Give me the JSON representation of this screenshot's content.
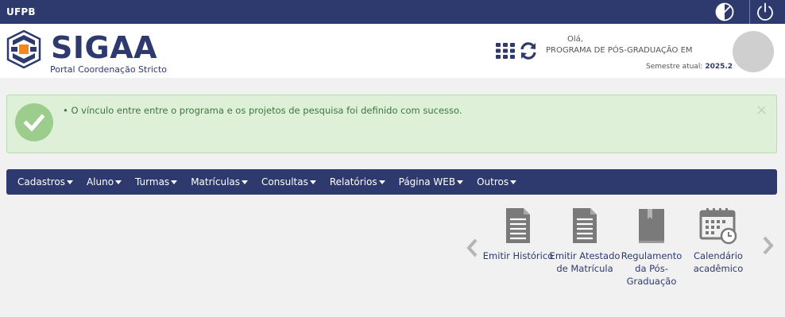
{
  "topbar": {
    "brand": "UFPB",
    "contrast_icon": "contrast-icon",
    "power_icon": "power-icon"
  },
  "header": {
    "logo_text": "SIGAA",
    "portal_subtitle": "Portal Coordenação Stricto",
    "greeting": "Olá,",
    "program": "PROGRAMA DE PÓS-GRADUAÇÃO EM",
    "semester_label": "Semestre atual:",
    "semester_value": "2025.2",
    "apps_icon": "grid-icon",
    "sync_icon": "sync-icon"
  },
  "alert": {
    "message": "• O vínculo entre entre o programa e os projetos de pesquisa foi definido com sucesso.",
    "close": "×",
    "color": "#dff0d8"
  },
  "menu": {
    "items": [
      {
        "label": "Cadastros"
      },
      {
        "label": "Aluno"
      },
      {
        "label": "Turmas"
      },
      {
        "label": "Matrículas"
      },
      {
        "label": "Consultas"
      },
      {
        "label": "Relatórios"
      },
      {
        "label": "Página WEB"
      },
      {
        "label": "Outros"
      }
    ],
    "color": "#2e3a6e"
  },
  "shortcuts": [
    {
      "label": "Emitir Histórico",
      "icon": "document-icon"
    },
    {
      "label": "Emitir Atestado de Matrícula",
      "icon": "document-icon"
    },
    {
      "label": "Regulamento da Pós-Graduação",
      "icon": "book-icon"
    },
    {
      "label": "Calendário acadêmico",
      "icon": "calendar-icon"
    }
  ],
  "colors": {
    "primary": "#2e3a6e",
    "success_text": "#3c763d",
    "success_bg": "#dff0d8",
    "icon_gray": "#7a7a7a"
  }
}
